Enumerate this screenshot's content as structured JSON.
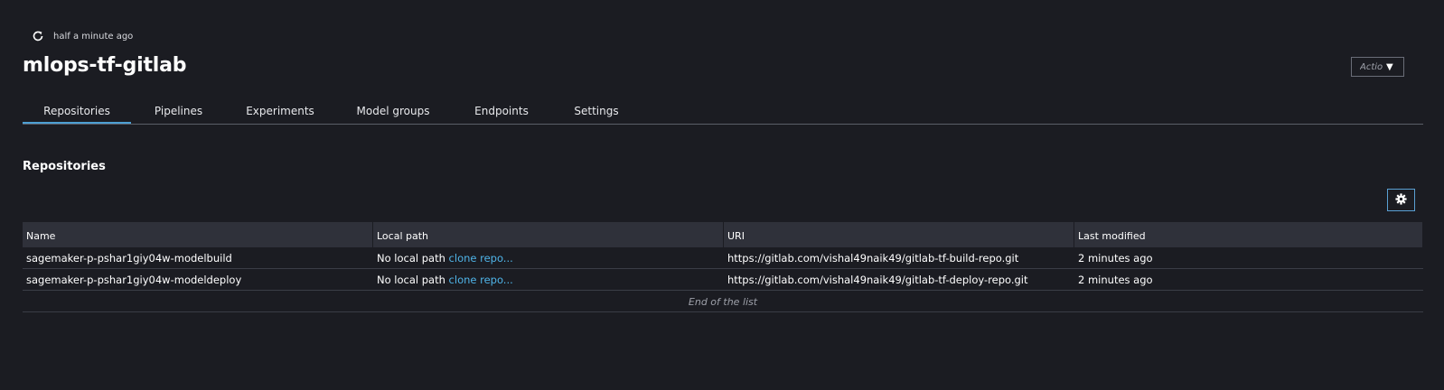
{
  "header": {
    "last_refreshed": "half a minute ago",
    "title": "mlops-tf-gitlab",
    "actions_label": "Actions",
    "refresh_icon": "refresh-icon",
    "caret_icon": "caret-down-icon"
  },
  "tabs": [
    {
      "label": "Repositories",
      "active": true
    },
    {
      "label": "Pipelines",
      "active": false
    },
    {
      "label": "Experiments",
      "active": false
    },
    {
      "label": "Model groups",
      "active": false
    },
    {
      "label": "Endpoints",
      "active": false
    },
    {
      "label": "Settings",
      "active": false
    }
  ],
  "repositories": {
    "section_title": "Repositories",
    "settings_icon": "gear-icon",
    "columns": [
      "Name",
      "Local path",
      "URI",
      "Last modified"
    ],
    "rows": [
      {
        "name": "sagemaker-p-pshar1giy04w-modelbuild",
        "local_path": "No local path",
        "clone_link": "clone repo...",
        "uri": "https://gitlab.com/vishal49naik49/gitlab-tf-build-repo.git",
        "last_modified": "2 minutes ago"
      },
      {
        "name": "sagemaker-p-pshar1giy04w-modeldeploy",
        "local_path": "No local path",
        "clone_link": "clone repo...",
        "uri": "https://gitlab.com/vishal49naik49/gitlab-tf-deploy-repo.git",
        "last_modified": "2 minutes ago"
      }
    ],
    "end_text": "End of the list"
  },
  "colors": {
    "background": "#1b1c22",
    "accent": "#4c9fd3",
    "link": "#4fb4e8",
    "table_header": "#2f313a"
  }
}
